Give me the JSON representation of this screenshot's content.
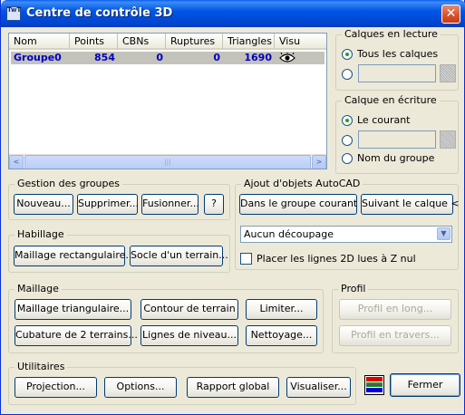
{
  "window": {
    "title": "Centre de contrôle 3D",
    "icon_text": "TwT",
    "close_symbol": "✕"
  },
  "listview": {
    "columns": [
      "Nom",
      "Points",
      "CBNs",
      "Ruptures",
      "Triangles",
      "Visu"
    ],
    "rows": [
      {
        "nom": "Groupe0",
        "points": "854",
        "cbns": "0",
        "ruptures": "0",
        "triangles": "1690",
        "visu_icon": "eye-icon"
      }
    ],
    "scroll_left": "<",
    "scroll_right": ">",
    "scroll_grip": "|||"
  },
  "calques_lecture": {
    "legend": "Calques en lecture",
    "option_all": "Tous les calques",
    "selected": "Tous les calques"
  },
  "calque_ecriture": {
    "legend": "Calque en écriture",
    "option_current": "Le courant",
    "option_group": "Nom du groupe",
    "selected": "Le courant"
  },
  "gestion_groupes": {
    "legend": "Gestion des groupes",
    "new_label": "Nouveau...",
    "delete_label": "Supprimer...",
    "merge_label": "Fusionner...",
    "help_label": "?"
  },
  "ajout_objets": {
    "legend": "Ajout d'objets AutoCAD",
    "current_group_label": "Dans le groupe courant <",
    "by_layer_label": "Suivant le calque <",
    "decoupage_value": "Aucun découpage",
    "lines_2d_label": "Placer les lignes 2D lues à Z nul",
    "lines_2d_checked": false
  },
  "habillage": {
    "legend": "Habillage",
    "rect_mesh_label": "Maillage rectangulaire...",
    "socle_label": "Socle d'un terrain..."
  },
  "maillage": {
    "legend": "Maillage",
    "tri_mesh_label": "Maillage triangulaire...",
    "contour_label": "Contour de terrain",
    "limit_label": "Limiter...",
    "cubature_label": "Cubature de 2 terrains...",
    "level_lines_label": "Lignes de niveau...",
    "cleanup_label": "Nettoyage..."
  },
  "profil": {
    "legend": "Profil",
    "long_label": "Profil en long...",
    "cross_label": "Profil en travers..."
  },
  "utilitaires": {
    "legend": "Utilitaires",
    "projection_label": "Projection...",
    "options_label": "Options...",
    "report_label": "Rapport global",
    "view_label": "Visualiser..."
  },
  "close_label": "Fermer",
  "colors": {
    "selection": "#316ac5",
    "value_text": "#0000c0",
    "title_bar": "#0055e5"
  }
}
